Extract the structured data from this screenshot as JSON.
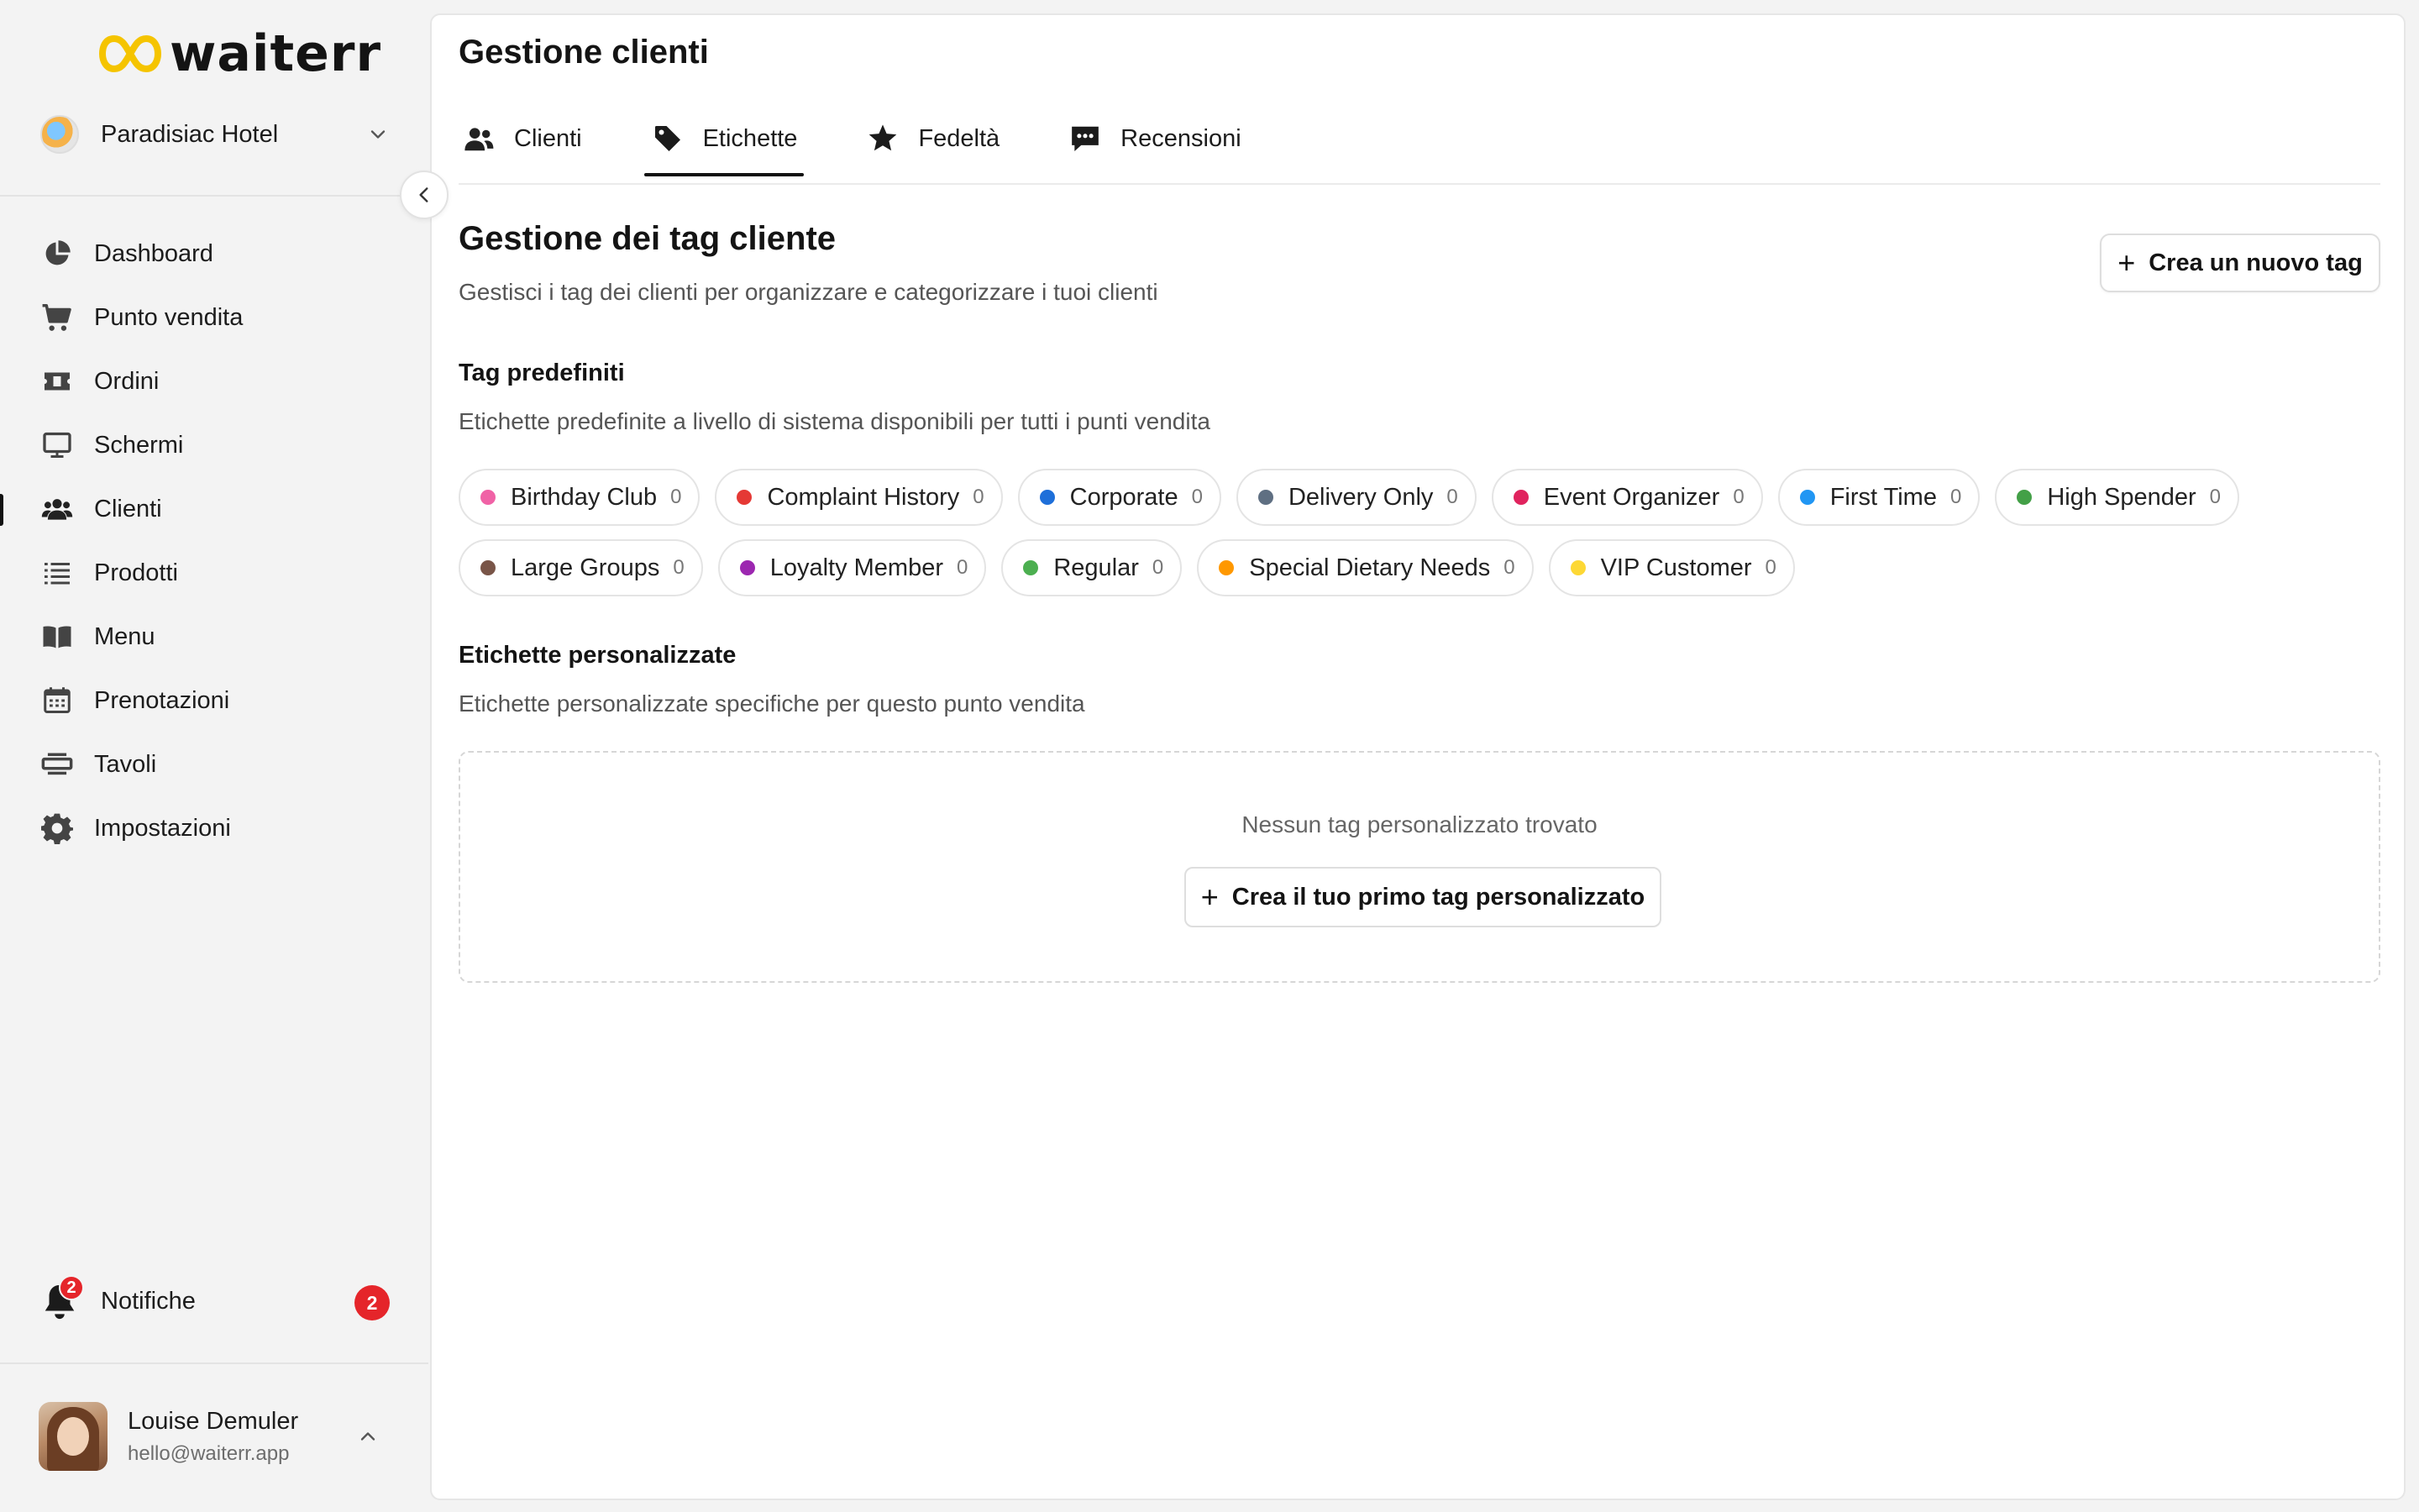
{
  "brand": {
    "name": "waiterr",
    "accent": "#f5c400"
  },
  "venue": {
    "name": "Paradisiac Hotel"
  },
  "nav": {
    "items": [
      {
        "label": "Dashboard",
        "icon": "pie-chart-icon"
      },
      {
        "label": "Punto vendita",
        "icon": "cart-icon"
      },
      {
        "label": "Ordini",
        "icon": "ticket-icon"
      },
      {
        "label": "Schermi",
        "icon": "monitor-icon"
      },
      {
        "label": "Clienti",
        "icon": "users-icon",
        "active": true
      },
      {
        "label": "Prodotti",
        "icon": "list-icon"
      },
      {
        "label": "Menu",
        "icon": "book-icon"
      },
      {
        "label": "Prenotazioni",
        "icon": "calendar-icon"
      },
      {
        "label": "Tavoli",
        "icon": "table-icon"
      },
      {
        "label": "Impostazioni",
        "icon": "gear-icon"
      }
    ]
  },
  "notifications": {
    "label": "Notifiche",
    "count": "2"
  },
  "user": {
    "name": "Louise Demuler",
    "email": "hello@waiterr.app"
  },
  "header": {
    "title": "Gestione clienti"
  },
  "tabs": [
    {
      "label": "Clienti",
      "icon": "users-icon"
    },
    {
      "label": "Etichette",
      "icon": "tag-icon",
      "active": true
    },
    {
      "label": "Fedeltà",
      "icon": "star-icon"
    },
    {
      "label": "Recensioni",
      "icon": "comment-icon"
    }
  ],
  "content": {
    "title": "Gestione dei tag cliente",
    "subtitle": "Gestisci i tag dei clienti per organizzare e categorizzare i tuoi clienti",
    "new_tag_button": "Crea un nuovo tag",
    "predefined": {
      "heading": "Tag predefiniti",
      "description": "Etichette predefinite a livello di sistema disponibili per tutti i punti vendita",
      "tags": [
        {
          "name": "Birthday Club",
          "count": "0",
          "color": "#f062a6"
        },
        {
          "name": "Complaint History",
          "count": "0",
          "color": "#e53935"
        },
        {
          "name": "Corporate",
          "count": "0",
          "color": "#1e6fd9"
        },
        {
          "name": "Delivery Only",
          "count": "0",
          "color": "#5f6f82"
        },
        {
          "name": "Event Organizer",
          "count": "0",
          "color": "#e0245e"
        },
        {
          "name": "First Time",
          "count": "0",
          "color": "#2196f3"
        },
        {
          "name": "High Spender",
          "count": "0",
          "color": "#43a047"
        },
        {
          "name": "Large Groups",
          "count": "0",
          "color": "#795548"
        },
        {
          "name": "Loyalty Member",
          "count": "0",
          "color": "#9c27b0"
        },
        {
          "name": "Regular",
          "count": "0",
          "color": "#4caf50"
        },
        {
          "name": "Special Dietary Needs",
          "count": "0",
          "color": "#ff9800"
        },
        {
          "name": "VIP Customer",
          "count": "0",
          "color": "#fdd835"
        }
      ]
    },
    "custom": {
      "heading": "Etichette personalizzate",
      "description": "Etichette personalizzate specifiche per questo punto vendita",
      "empty_text": "Nessun tag personalizzato trovato",
      "create_first_button": "Crea il tuo primo tag personalizzato"
    }
  }
}
